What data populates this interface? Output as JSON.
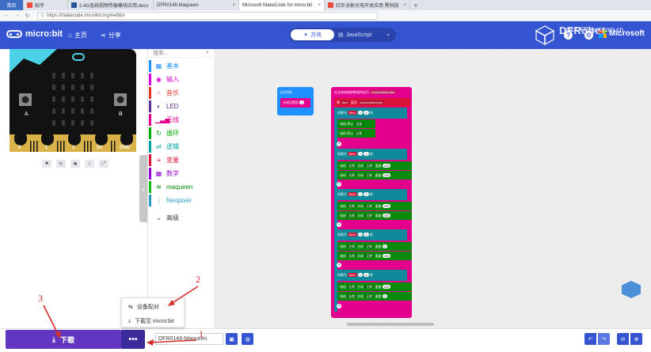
{
  "browser": {
    "tabs": [
      {
        "label": "首页",
        "color": "#3d70c4"
      },
      {
        "label": "知乎",
        "color": "#e94e3c"
      },
      {
        "label": "2.4G无线视频传输模块应用.docx",
        "color": "#2b579a"
      },
      {
        "label": "DFR0148-Maqueen",
        "color": "#888888"
      },
      {
        "label": "Microsoft MakeCode for micro:bit",
        "color": "#3454d1"
      },
      {
        "label": "红外对射光电开关应用 黑科技",
        "color": "#e94e3c"
      }
    ],
    "url": "https://makecode.microbit.org/#editor"
  },
  "header": {
    "logo": "micro:bit",
    "home": "主页",
    "share": "分享",
    "mode_blocks": "方块",
    "mode_js": "JavaScript",
    "watermark": "DFRobot",
    "watermark_url": "mc.DFRobot.com.cn",
    "microsoft": "Microsoft",
    "icons": [
      "help-icon",
      "settings-icon"
    ]
  },
  "simulator": {
    "pins": [
      "0",
      "1",
      "2",
      "3V",
      "GND"
    ],
    "button_a": "A",
    "button_b": "B",
    "controls": [
      "stop-icon",
      "restart-icon",
      "slowmo-icon",
      "mute-icon",
      "fullscreen-icon"
    ]
  },
  "toolbox": {
    "search_placeholder": "搜索...",
    "categories": [
      {
        "label": "基本",
        "color": "#1e90ff",
        "icon": "grid-icon"
      },
      {
        "label": "输入",
        "color": "#d400d4",
        "icon": "input-icon"
      },
      {
        "label": "音乐",
        "color": "#e63022",
        "icon": "headphones-icon"
      },
      {
        "label": "LED",
        "color": "#5c2d91",
        "icon": "toggle-icon"
      },
      {
        "label": "无线",
        "color": "#e3008c",
        "icon": "signal-icon"
      },
      {
        "label": "循环",
        "color": "#00aa00",
        "icon": "loop-icon"
      },
      {
        "label": "逻辑",
        "color": "#00a4a6",
        "icon": "logic-icon"
      },
      {
        "label": "变量",
        "color": "#dc143c",
        "icon": "variables-icon"
      },
      {
        "label": "数学",
        "color": "#9400d3",
        "icon": "math-icon"
      },
      {
        "label": "maqueen",
        "color": "#0fbc11",
        "icon": "wifi-icon"
      },
      {
        "label": "Neopixel",
        "color": "#2699bf",
        "icon": "neopixel-icon"
      },
      {
        "label": "高级",
        "color": "#3c3c3c",
        "icon": "chevron-down-icon"
      }
    ]
  },
  "blocks": {
    "on_start": "当开机时",
    "on_start_radio": "无线设置组",
    "radio_group_value": "1",
    "received_event": "在无线电接收数值时运行",
    "received_param": "receivedNumber",
    "set_prefix": "将",
    "set_var": "item",
    "set_to": "设为",
    "set_value": "receivedNumber",
    "if_label": "如果为",
    "then_label": "则",
    "eq": "=",
    "motor_stop": "电机 停止",
    "left_all": "全部",
    "right_all": "右侧",
    "motor": "电机",
    "left": "左侧",
    "right": "右侧",
    "direction": "方向",
    "forward": "正转",
    "speed": "速度",
    "branches": [
      {
        "cond": "0",
        "speeds": []
      },
      {
        "cond": "1",
        "speeds": [
          "255",
          "255"
        ]
      },
      {
        "cond": "2",
        "speeds": [
          "255",
          "255"
        ]
      },
      {
        "cond": "3",
        "speeds": [
          "0",
          "255"
        ]
      },
      {
        "cond": "4",
        "speeds": [
          "255",
          "0"
        ]
      }
    ]
  },
  "bottom": {
    "download": "下载",
    "more": "•••",
    "project_name": "DFR0148-Maqueen",
    "menu_items": [
      "设备配对",
      "下载至 micro:bit"
    ]
  },
  "annotations": [
    "1",
    "2",
    "3"
  ]
}
